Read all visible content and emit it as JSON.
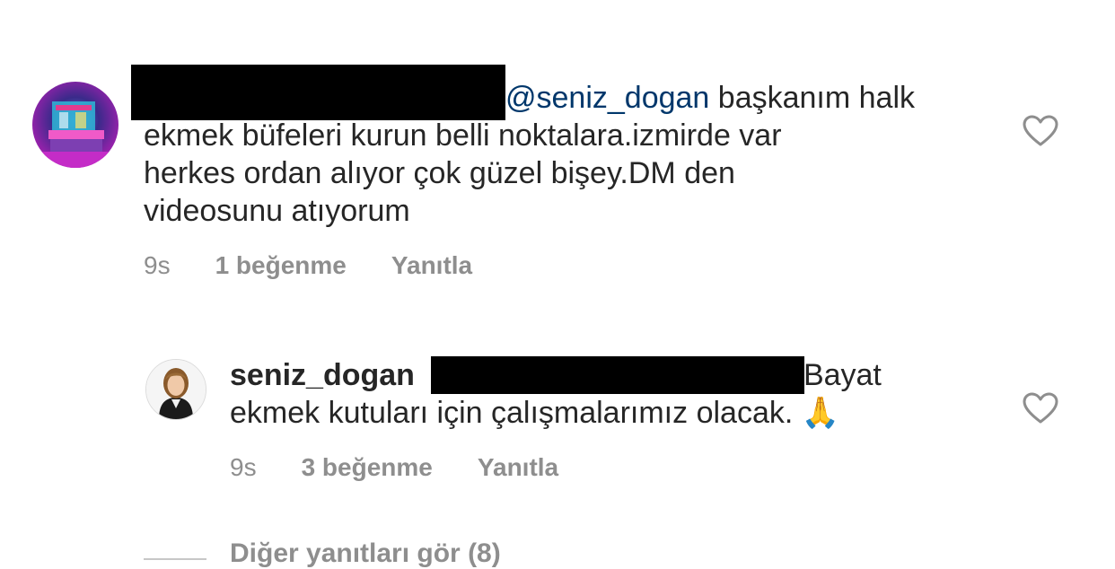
{
  "comment": {
    "mention": "@seniz_dogan",
    "lines": [
      " başkanım halk",
      "ekmek büfeleri kurun belli noktalara.izmirde var",
      "herkes ordan alıyor çok güzel bişey.DM den",
      "videosunu atıyorum"
    ],
    "time": "9s",
    "likes": "1 beğenme",
    "reply_label": "Yanıtla"
  },
  "reply": {
    "username": "seniz_dogan",
    "line1_tail": "Bayat",
    "line2": "ekmek kutuları için çalışmalarımız olacak. ",
    "emoji": "🙏",
    "time": "9s",
    "likes": "3 beğenme",
    "reply_label": "Yanıtla"
  },
  "view_more_replies": "Diğer yanıtları gör (8)",
  "colors": {
    "text": "#262626",
    "mention": "#00376b",
    "meta": "#8e8e8e",
    "redaction": "#000000"
  },
  "icons": {
    "heart": "heart-outline-icon"
  }
}
